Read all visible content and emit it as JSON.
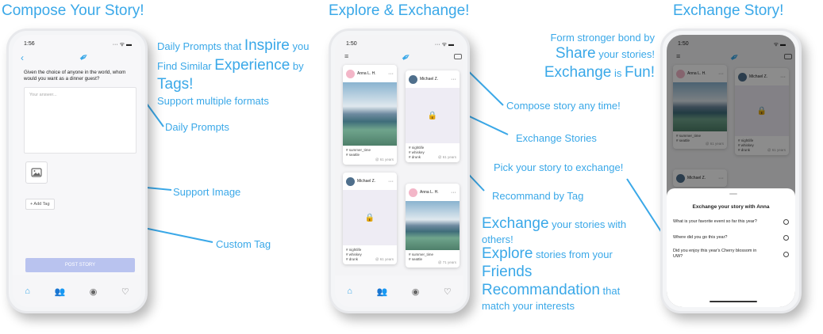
{
  "headings": {
    "compose": "Compose Your Story!",
    "explore": "Explore & Exchange!",
    "exchange": "Exchange Story!"
  },
  "compose_phone": {
    "time": "1:56",
    "prompt": "Given the choice of anyone in the world, whom would you want as a dinner guest?",
    "answer_placeholder": "Your answer...",
    "add_tag": "+ Add Tag",
    "post_button": "POST STORY"
  },
  "compose_annotations": {
    "line1_pre": "Daily Prompts that ",
    "line1_big": "Inspire",
    "line1_post": " you",
    "line2_pre": "Find Similar ",
    "line2_big": "Experience",
    "line2_post": " by",
    "line3_big": "Tags!",
    "line4": "Support multiple formats",
    "daily_prompts": "Daily Prompts",
    "support_image": "Support Image",
    "custom_tag": "Custom Tag"
  },
  "explore_phone": {
    "time": "1:50",
    "cards": [
      {
        "user": "Anna L. H.",
        "tags": "# summer_time\n# seattle",
        "time": "@ 61 years",
        "kind": "image"
      },
      {
        "user": "Michael Z.",
        "tags": "# nightlife\n# whiskey\n# drunk",
        "time": "@ 61 years",
        "kind": "locked"
      },
      {
        "user": "Michael Z.",
        "tags": "# nightlife\n# whiskey\n# drunk",
        "time": "@ 61 years",
        "kind": "locked"
      },
      {
        "user": "Anna L. H.",
        "tags": "# summer_time\n# seattle",
        "time": "@ 71 years",
        "kind": "image"
      }
    ]
  },
  "explore_annotations": {
    "compose_any_time": "Compose story any time!",
    "exchange_stories": "Exchange Stories",
    "recommand_by_tag": "Recommand by Tag",
    "exchange_big": "Exchange",
    "exchange_rest": " your stories with",
    "exchange_rest2": "others!",
    "explore_big": "Explore",
    "explore_rest": " stories from your",
    "friends_big": "Friends",
    "recommand_big": "Recommandation",
    "recommand_rest": " that",
    "recommand_rest2": "match your interests"
  },
  "exchange_annotations": {
    "line1": "Form stronger bond by",
    "share_big": "Share",
    "share_rest": " your stories!",
    "exchange_big": "Exchange",
    "exchange_rest": " is ",
    "fun_big": "Fun!",
    "pick": "Pick your story to exchange!"
  },
  "exchange_phone": {
    "time": "1:50",
    "sheet_title": "Exchange your story with Anna",
    "options": [
      "What is your favorite event so far this year?",
      "Where did you go this year?",
      "Did you enjoy this year's Cherry blossom in UW?"
    ],
    "bg_cards": [
      {
        "user": "Anna L. H.",
        "tags": "# summer_time\n# seattle",
        "time": "@ 61 years"
      },
      {
        "user": "Michael Z.",
        "tags": "# nightlife\n# whiskey\n# drunk",
        "time": "@ 61 years"
      },
      {
        "user": "Michael Z."
      }
    ]
  },
  "colors": {
    "accent": "#3aa8e8",
    "button_disabled": "#b9c3ef"
  },
  "icons": [
    "home-icon",
    "people-icon",
    "profile-icon",
    "heart-icon",
    "feather-icon",
    "camera-icon",
    "menu-icon",
    "lock-icon",
    "image-icon",
    "back-icon"
  ]
}
